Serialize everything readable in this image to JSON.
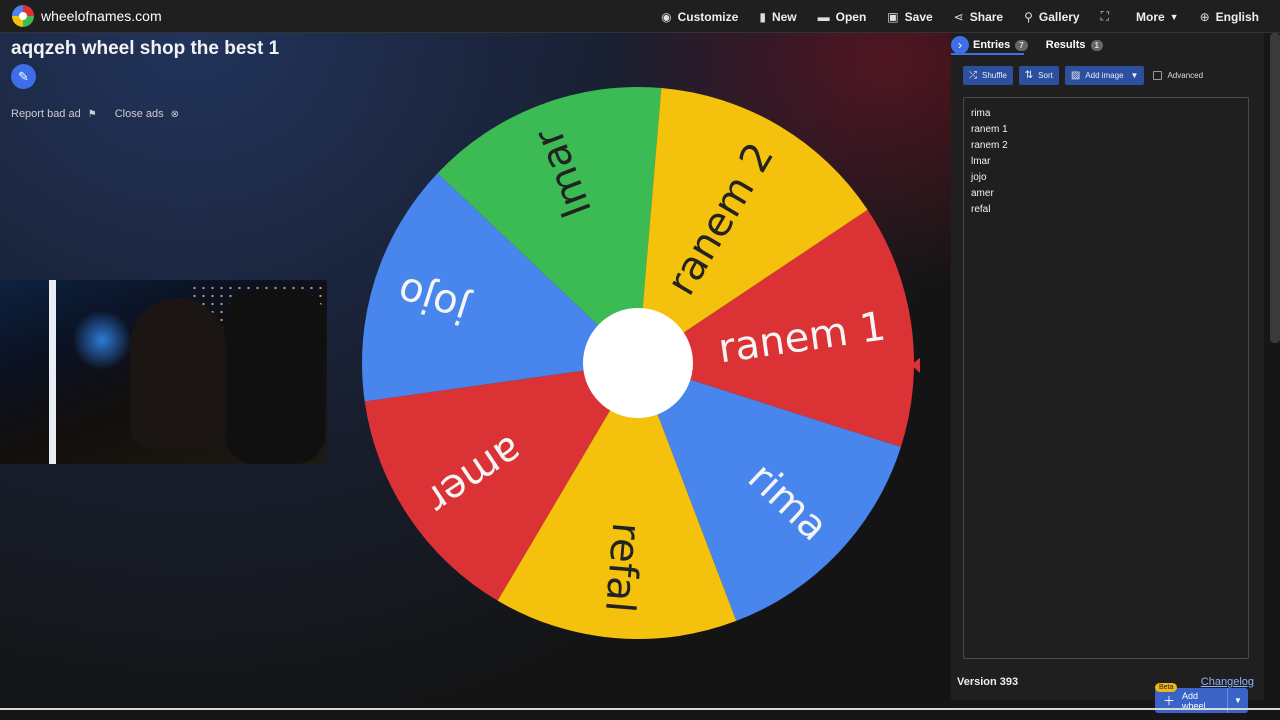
{
  "app": {
    "site_name": "wheelofnames.com"
  },
  "menu": {
    "items": [
      {
        "label": "Customize",
        "icon": "palette-icon"
      },
      {
        "label": "New",
        "icon": "file-icon"
      },
      {
        "label": "Open",
        "icon": "folder-icon"
      },
      {
        "label": "Save",
        "icon": "save-icon"
      },
      {
        "label": "Share",
        "icon": "share-icon"
      },
      {
        "label": "Gallery",
        "icon": "search-icon"
      },
      {
        "label": "",
        "icon": "fullscreen-icon"
      },
      {
        "label": "More",
        "icon": "chevron-down-icon"
      },
      {
        "label": "English",
        "icon": "globe-icon"
      }
    ]
  },
  "wheel": {
    "title": "aqqzeh wheel shop the best 1",
    "segments": [
      {
        "label": "ranem 1",
        "color": "#db3236"
      },
      {
        "label": "rima",
        "color": "#4885ed"
      },
      {
        "label": "refal",
        "color": "#f4c20d"
      },
      {
        "label": "amer",
        "color": "#db3236"
      },
      {
        "label": "jojo",
        "color": "#4885ed"
      },
      {
        "label": "lmar",
        "color": "#3cba54"
      },
      {
        "label": "ranem 2",
        "color": "#f4c20d"
      }
    ],
    "pointer_color": "#db3236"
  },
  "ads": {
    "report_label": "Report bad ad",
    "close_label": "Close ads"
  },
  "sidebar": {
    "tabs": [
      {
        "label": "Entries",
        "count": "7"
      },
      {
        "label": "Results",
        "count": "1"
      }
    ],
    "toolbar": {
      "shuffle": "Shuffle",
      "sort": "Sort",
      "add_image": "Add image",
      "advanced": "Advanced"
    },
    "entries": [
      "rima",
      "ranem 1",
      "ranem 2",
      "lmar",
      "jojo",
      "amer",
      "refal"
    ],
    "add_wheel": {
      "label": "Add wheel",
      "badge": "Beta"
    },
    "version": "Version 393",
    "changelog": "Changelog"
  },
  "colors": {
    "accent": "#3f6fe6",
    "background": "#141414",
    "panel": "#1f1f1f"
  }
}
